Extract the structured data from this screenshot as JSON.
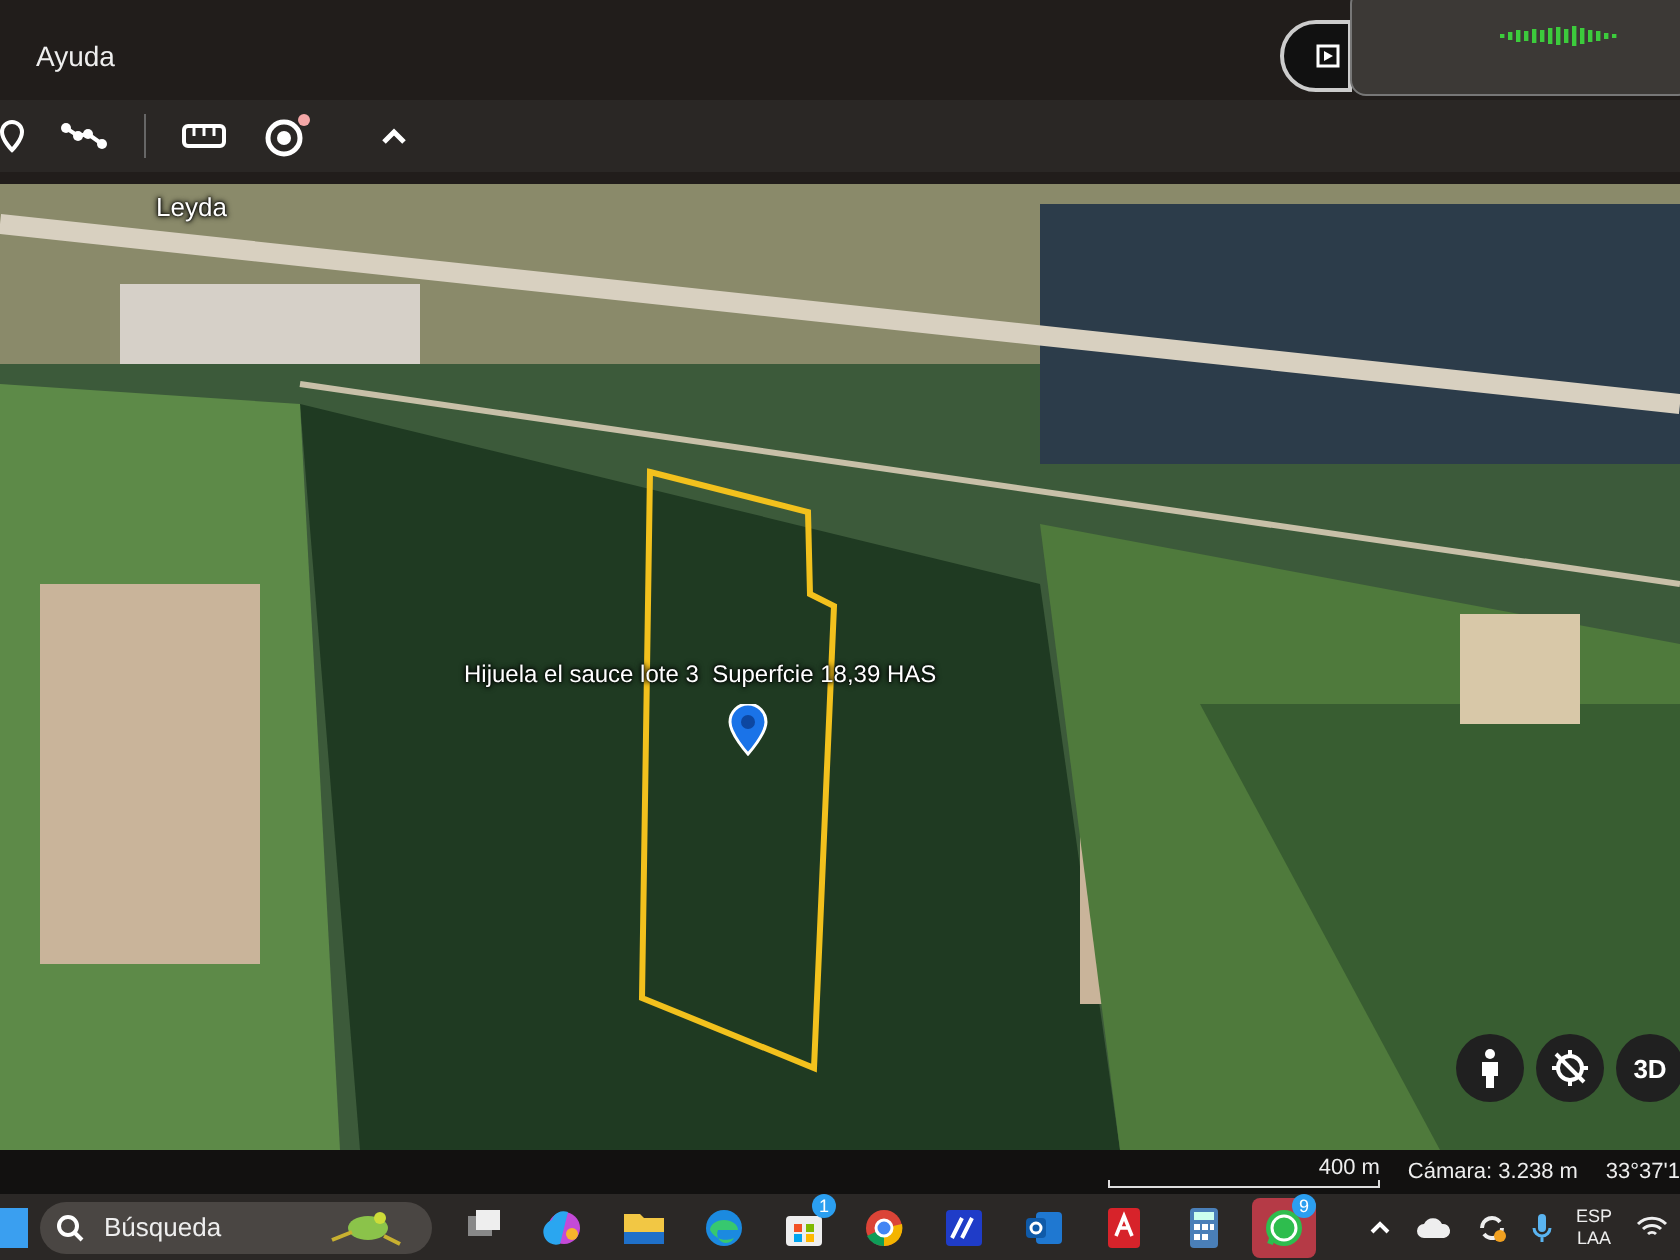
{
  "header": {
    "menu": [
      "Ayuda"
    ]
  },
  "map": {
    "place_label": "Leyda",
    "parcel_label": "Hijuela el sauce lote 3  Superfcie 18,39 HAS",
    "view_button": "3D"
  },
  "status_bar": {
    "scale": "400 m",
    "camera": "Cámara: 3.238 m",
    "coordinates": "33°37'1"
  },
  "taskbar": {
    "search": {
      "placeholder": "Búsqueda"
    },
    "apps": [
      {
        "kind": "taskview",
        "selected": false
      },
      {
        "kind": "copilot",
        "selected": false
      },
      {
        "kind": "folder",
        "selected": false
      },
      {
        "kind": "edge",
        "selected": false
      },
      {
        "kind": "store",
        "selected": false,
        "badge": "1"
      },
      {
        "kind": "chrome",
        "selected": false
      },
      {
        "kind": "mail-blue",
        "selected": false
      },
      {
        "kind": "outlook",
        "selected": false
      },
      {
        "kind": "cad",
        "selected": false
      },
      {
        "kind": "calculator",
        "selected": false
      },
      {
        "kind": "whatsapp",
        "selected": true,
        "badge": "9"
      }
    ],
    "language": [
      "ESP",
      "LAA"
    ]
  }
}
